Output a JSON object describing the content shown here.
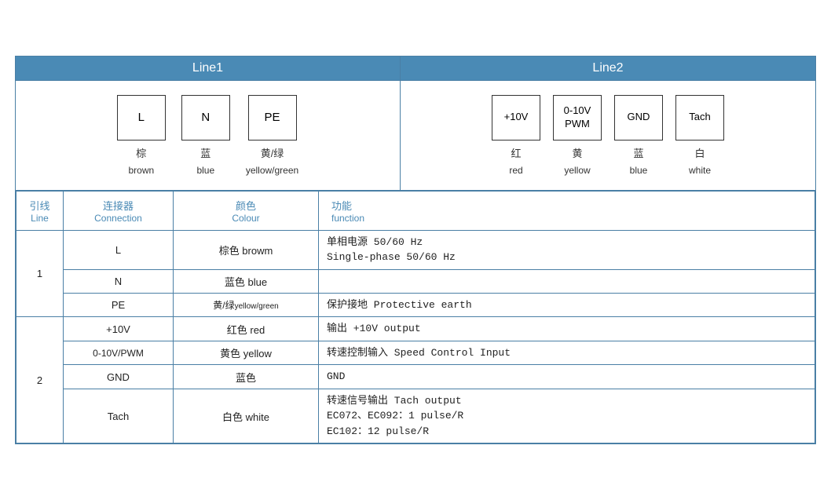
{
  "header": {
    "line1": "Line1",
    "line2": "Line2"
  },
  "diagram": {
    "line1_connectors": [
      {
        "label": "L",
        "cn": "棕",
        "en": "brown"
      },
      {
        "label": "N",
        "cn": "蓝",
        "en": "blue"
      },
      {
        "label": "PE",
        "cn": "黄/绿",
        "en": "yellow/green"
      }
    ],
    "line2_connectors": [
      {
        "label": "+10V",
        "cn": "红",
        "en": "red"
      },
      {
        "label": "0-10V\nPWM",
        "cn": "黄",
        "en": "yellow"
      },
      {
        "label": "GND",
        "cn": "蓝",
        "en": "blue"
      },
      {
        "label": "Tach",
        "cn": "白",
        "en": "white"
      }
    ]
  },
  "table": {
    "headers": {
      "line": {
        "cn": "引线",
        "en": "Line"
      },
      "connection": {
        "cn": "连接器",
        "en": "Connection"
      },
      "colour": {
        "cn": "颜色",
        "en": "Colour"
      },
      "function": {
        "cn": "功能",
        "en": "function"
      }
    },
    "rows": [
      {
        "line_num": "1",
        "rowspan": 3,
        "entries": [
          {
            "connection": "L",
            "colour_cn": "棕色",
            "colour_en": "browm",
            "function": "单相电源 50/60 Hz\nSingle-phase 50/60 Hz"
          },
          {
            "connection": "N",
            "colour_cn": "蓝色",
            "colour_en": "blue",
            "function": ""
          },
          {
            "connection": "PE",
            "colour_cn": "黄/绿",
            "colour_en": "yellow/green",
            "function": "保护接地 Protective earth"
          }
        ]
      },
      {
        "line_num": "2",
        "rowspan": 4,
        "entries": [
          {
            "connection": "+10V",
            "colour_cn": "红色",
            "colour_en": "red",
            "function": "输出 +10V output"
          },
          {
            "connection": "0-10V/PWM",
            "colour_cn": "黄色",
            "colour_en": "yellow",
            "function": "转速控制输入 Speed Control Input"
          },
          {
            "connection": "GND",
            "colour_cn": "蓝色",
            "colour_en": "",
            "function": "GND"
          },
          {
            "connection": "Tach",
            "colour_cn": "白色",
            "colour_en": "white",
            "function": "转速信号输出 Tach output\nEC072、EC092：1 pulse/R\nEC102：12 pulse/R"
          }
        ]
      }
    ]
  }
}
